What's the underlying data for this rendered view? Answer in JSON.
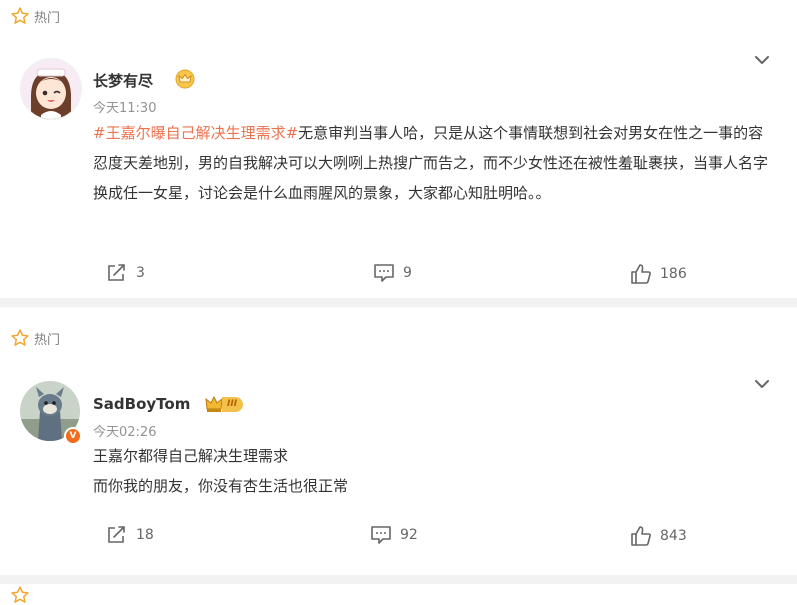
{
  "comments": [
    {
      "hot_label": "热门",
      "username": "长梦有尽",
      "time": "今天11:30",
      "topic": "#王嘉尔曝自己解决生理需求#",
      "body": "无意审判当事人哈，只是从这个事情联想到社会对男女在性之一事的容忍度天差地别，男的自我解决可以大咧咧上热搜广而告之，而不少女性还在被性羞耻裹挟，当事人名字换成任一女星，讨论会是什么血雨腥风的景象，大家都心知肚明哈。。",
      "reposts": "3",
      "comments": "9",
      "likes": "186"
    },
    {
      "hot_label": "热门",
      "username": "SadBoyTom",
      "level": "III",
      "verified": "V",
      "time": "今天02:26",
      "line1": "王嘉尔都得自己解决生理需求",
      "line2": "而你我的朋友，你没有杏生活也很正常",
      "reposts": "18",
      "comments": "92",
      "likes": "843"
    }
  ],
  "colors": {
    "topic": "#eb7350",
    "star": "#f0a830",
    "verified": "#f56b1a",
    "divider": "#f2f2f2"
  },
  "icons": [
    "star-icon",
    "chevron-down-icon",
    "repost-icon",
    "comment-icon",
    "like-icon",
    "crown-badge-icon"
  ]
}
